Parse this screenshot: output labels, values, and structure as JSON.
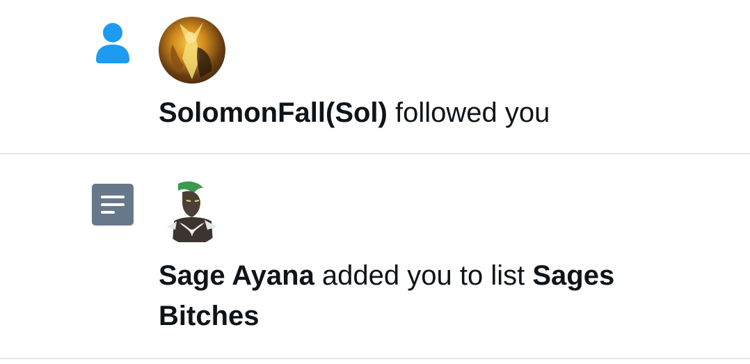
{
  "colors": {
    "follow_icon": "#1d9bf0",
    "list_icon": "#66788a",
    "text": "#0f1419",
    "divider": "#e1e6ea"
  },
  "notifications": [
    {
      "type": "follow",
      "type_icon": "person-icon",
      "avatar_icon": "avatar",
      "actor": "SolomonFall(Sol)",
      "action": " followed you"
    },
    {
      "type": "list",
      "type_icon": "list-icon",
      "avatar_icon": "avatar",
      "actor": "Sage Ayana",
      "action": " added you to list ",
      "list_name": "Sages Bitches"
    }
  ]
}
